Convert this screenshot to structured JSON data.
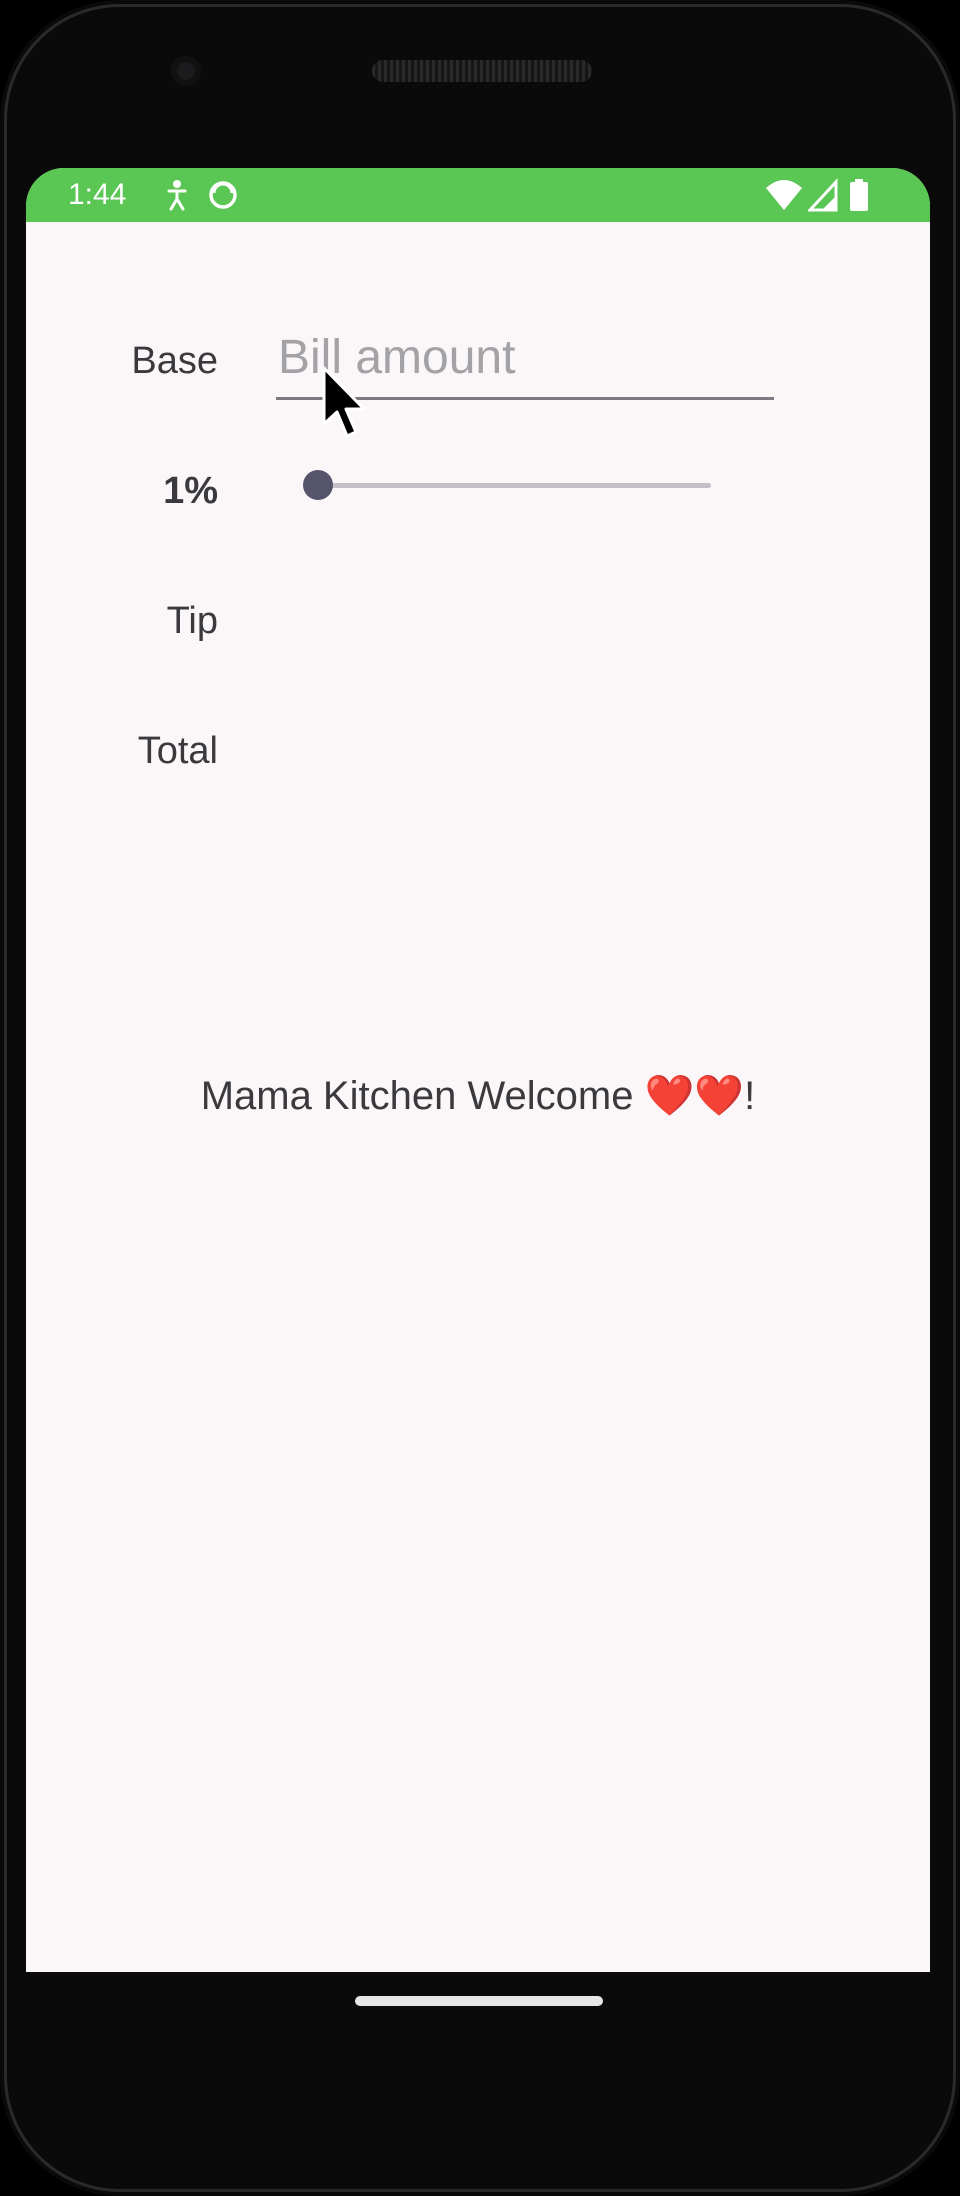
{
  "status_bar": {
    "time": "1:44",
    "left_icons": [
      "accessibility-icon",
      "sync-icon"
    ],
    "right_icons": [
      "wifi-icon",
      "cellular-signal-icon",
      "battery-icon"
    ],
    "color": "#5ac653"
  },
  "form": {
    "base_label": "Base",
    "bill_placeholder": "Bill amount",
    "bill_value": "",
    "tip_percent_label": "1%",
    "tip_percent_value": 1,
    "tip_label": "Tip",
    "tip_value": "",
    "total_label": "Total",
    "total_value": ""
  },
  "footer": {
    "welcome_text": "Mama Kitchen Welcome ",
    "hearts": "❤️❤️",
    "suffix": "!"
  }
}
